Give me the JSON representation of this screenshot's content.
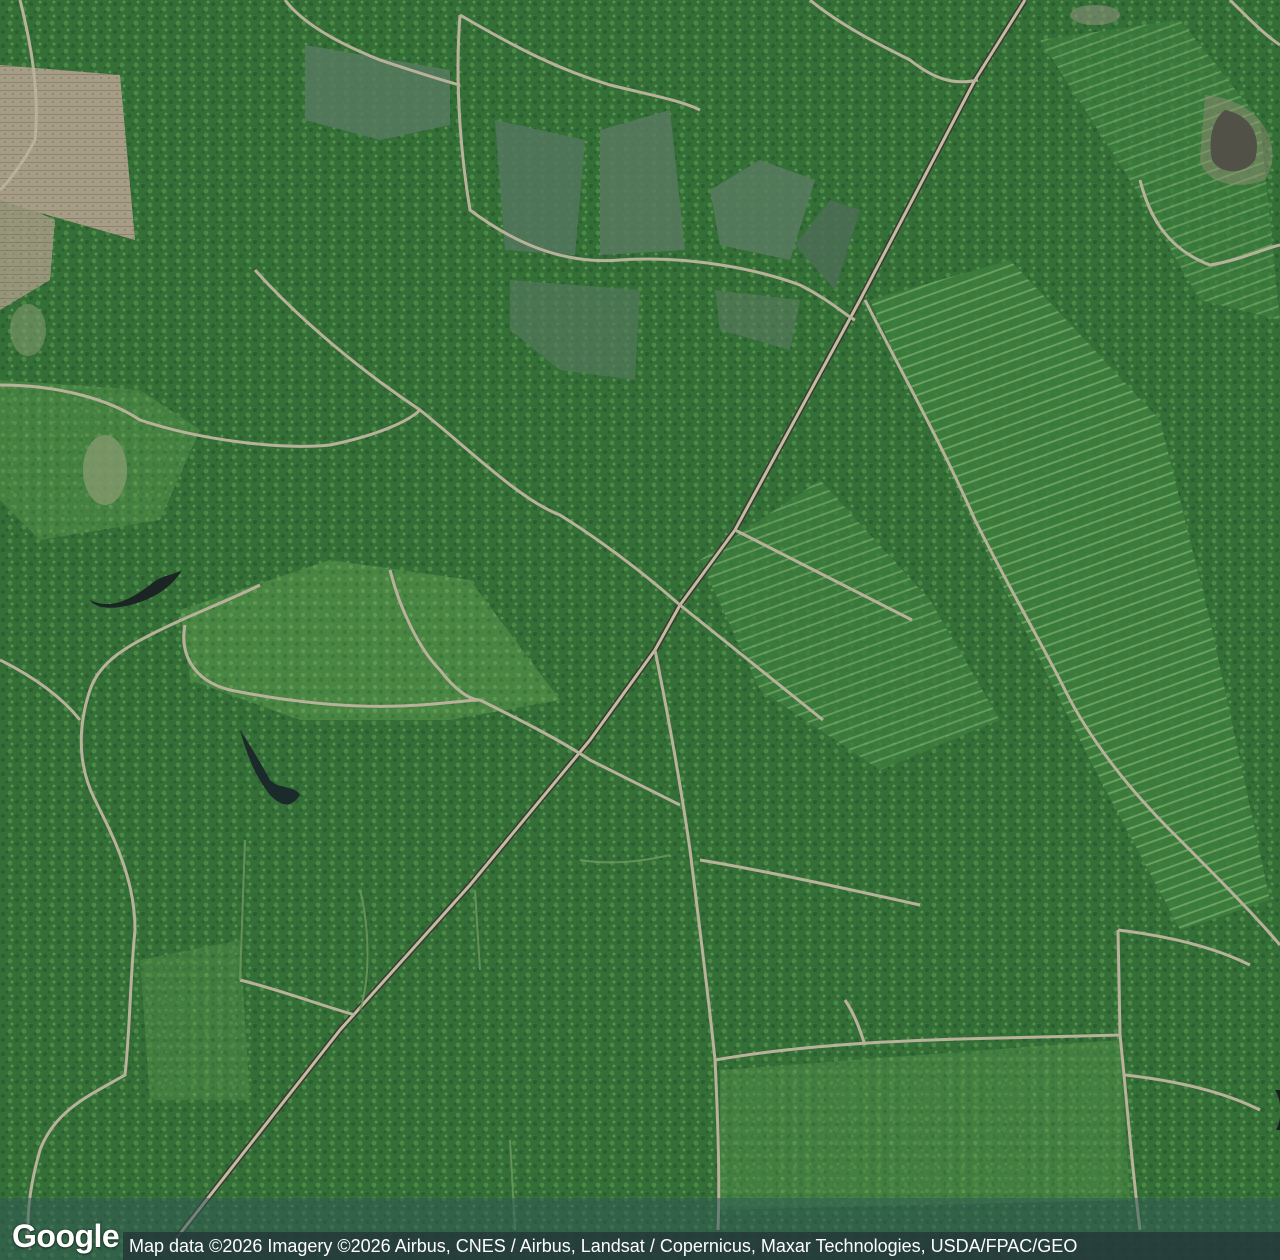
{
  "map": {
    "type": "satellite",
    "colors": {
      "forest_dark": "#2a5f30",
      "forest_mid": "#3f7e3e",
      "forest_light": "#5d9650",
      "clearing_brown": "#9e927a",
      "clearcut_grey": "#5f7a64",
      "road": "#b8b29a",
      "road_dark_edge": "#3a3a30",
      "water": "#1d2b2a",
      "bottom_band": "#2f5a55"
    }
  },
  "branding": {
    "logo": "Google"
  },
  "attribution": {
    "text": "Map data ©2026 Imagery ©2026 Airbus, CNES / Airbus, Landsat / Copernicus, Maxar Technologies, USDA/FPAC/GEO"
  }
}
